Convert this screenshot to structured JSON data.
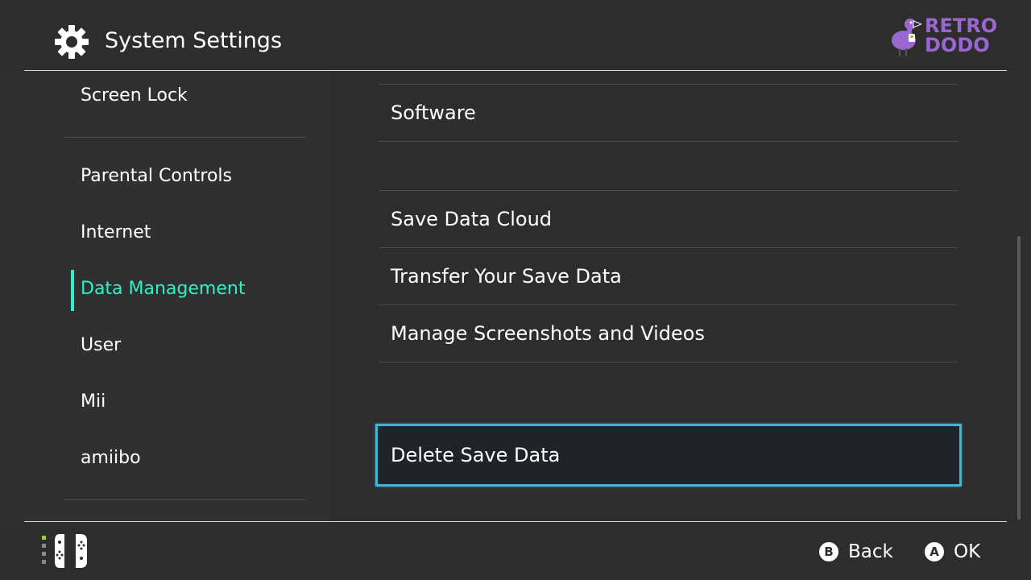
{
  "header": {
    "title": "System Settings",
    "logo_line1": "RETRO",
    "logo_line2": "DODO"
  },
  "sidebar": {
    "items": [
      {
        "label": "Screen Lock",
        "active": false
      },
      {
        "label": "Parental Controls",
        "active": false
      },
      {
        "label": "Internet",
        "active": false
      },
      {
        "label": "Data Management",
        "active": true
      },
      {
        "label": "User",
        "active": false
      },
      {
        "label": "Mii",
        "active": false
      },
      {
        "label": "amiibo",
        "active": false
      }
    ]
  },
  "main": {
    "items": [
      {
        "label": "Software"
      },
      {
        "label": "Save Data Cloud"
      },
      {
        "label": "Transfer Your Save Data"
      },
      {
        "label": "Manage Screenshots and Videos"
      }
    ],
    "selected": {
      "label": "Delete Save Data"
    }
  },
  "footer": {
    "back": {
      "key": "B",
      "label": "Back"
    },
    "ok": {
      "key": "A",
      "label": "OK"
    }
  },
  "colors": {
    "background": "#2d2d2d",
    "sidebar": "#303030",
    "accent": "#2ff0c8",
    "selection_border": "#3fb6d8",
    "logo": "#9a66d0"
  }
}
